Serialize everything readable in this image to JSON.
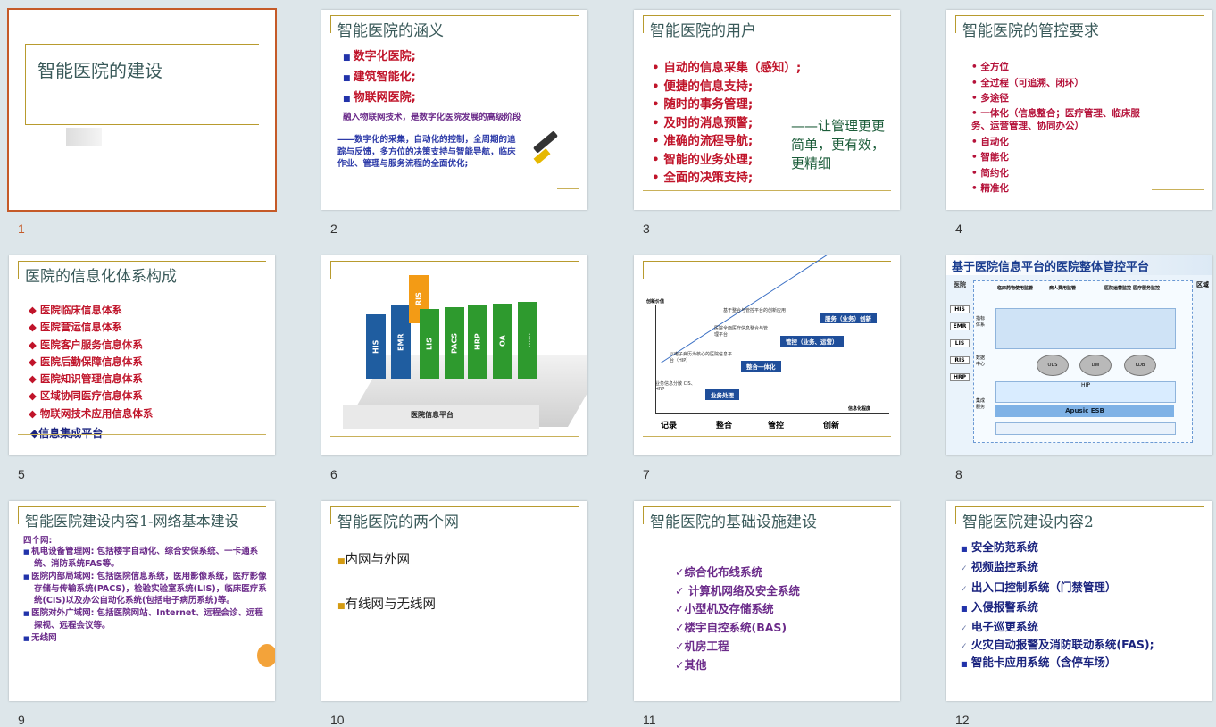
{
  "slides": [
    {
      "n": "1",
      "title": "智能医院的建设"
    },
    {
      "n": "2",
      "title": "智能医院的涵义",
      "items": [
        "数字化医院;",
        "建筑智能化;",
        "物联网医院;"
      ],
      "sub": "融入物联网技术，是数字化医院发展的高级阶段",
      "desc": "——数字化的采集，自动化的控制，全周期的追踪与反馈，多方位的决策支持与智能导航，临床作业、管理与服务流程的全面优化;"
    },
    {
      "n": "3",
      "title": "智能医院的用户",
      "items": [
        "自动的信息采集（感知）;",
        "便捷的信息支持;",
        "随时的事务管理;",
        "及时的消息预警;",
        "准确的流程导航;",
        "智能的业务处理;",
        "全面的决策支持;"
      ],
      "note": "——让管理更更简单，更有效，更精细"
    },
    {
      "n": "4",
      "title": "智能医院的管控要求",
      "items": [
        "全方位",
        "全过程（可追溯、闭环）",
        "多途径",
        "一体化（信息整合；医疗管理、临床服务、运营管理、协同办公）",
        "自动化",
        "智能化",
        "简约化",
        "精准化"
      ]
    },
    {
      "n": "5",
      "title": "医院的信息化体系构成",
      "items": [
        "医院临床信息体系",
        "医院营运信息体系",
        "医院客户服务信息体系",
        "医院后勤保障信息体系",
        "医院知识管理信息体系",
        "区域协同医疗信息体系",
        "物联网技术应用信息体系"
      ],
      "last": "◆信息集成平台"
    },
    {
      "n": "6",
      "bars": [
        "HIS",
        "EMR",
        "RIS",
        "LIS",
        "PACS",
        "HRP",
        "OA",
        "……"
      ],
      "base": "医院信息平台"
    },
    {
      "n": "7",
      "ylabel": "创新价值",
      "xlabel": "信息化程度",
      "steps": [
        "业务处理",
        "整合一体化",
        "管控（业务、运营）",
        "服务（业务）创新"
      ],
      "notes": [
        "业务信息分散 CIS、HRP",
        "以电子病历为核心的医院信息平台（HIP）",
        "医院全面医疗信息整合与管理平台",
        "基于整合与管控平台的创新应用"
      ],
      "stages": [
        "记录",
        "整合",
        "管控",
        "创新"
      ]
    },
    {
      "n": "8",
      "title": "基于医院信息平台的医院整体管控平台",
      "left": [
        "医院",
        "HIS",
        "EMR",
        "LIS",
        "RIS",
        "HRP"
      ],
      "right": [
        "区域"
      ],
      "labels": [
        "临床药物使用监管",
        "病人费用监管",
        "医院运营监控",
        "医疗服务监控",
        "指标体系",
        "数据中心",
        "集成服务",
        "ODS",
        "DW",
        "KDB",
        "HIP",
        "Apusic ESB"
      ]
    },
    {
      "n": "9",
      "title": "智能医院建设内容1-网络基本建设",
      "head": "四个网:",
      "items": [
        "机电设备管理网: 包括楼宇自动化、综合安保系统、一卡通系统、消防系统FAS等。",
        "医院内部局域网: 包括医院信息系统，医用影像系统，医疗影像存储与传输系统(PACS)，检验实验室系统(LIS)，临床医疗系统(CIS)以及办公自动化系统(包括电子病历系统)等。",
        "医院对外广域网: 包括医院网站、Internet、远程会诊、远程探视、远程会议等。",
        "无线网"
      ]
    },
    {
      "n": "10",
      "title": "智能医院的两个网",
      "items": [
        "内网与外网",
        "有线网与无线网"
      ]
    },
    {
      "n": "11",
      "title": "智能医院的基础设施建设",
      "items": [
        "综合化布线系统",
        "计算机网络及安全系统",
        "小型机及存储系统",
        "楼宇自控系统(BAS)",
        "机房工程",
        "其他"
      ]
    },
    {
      "n": "12",
      "title": "智能医院建设内容2",
      "items": [
        "安全防范系统",
        "视频监控系统",
        "出入口控制系统（门禁管理）",
        "入侵报警系统",
        "电子巡更系统",
        "火灾自动报警及消防联动系统(FAS);",
        "智能卡应用系统（含停车场）"
      ]
    }
  ],
  "colors": {
    "accent": "#c55a28",
    "title": "#3a5a5a",
    "rule": "#b89b2e",
    "red": "#c0142a",
    "purple": "#6b2b8a",
    "navy": "#1a237e"
  }
}
